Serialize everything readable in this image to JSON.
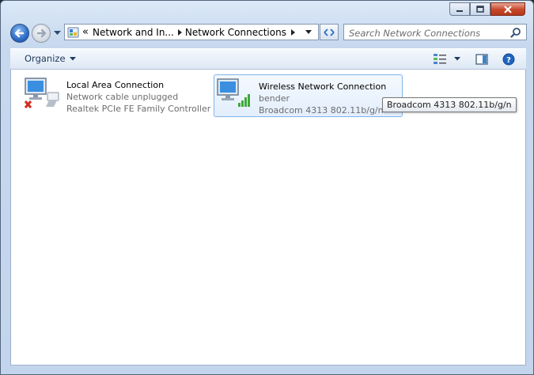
{
  "breadcrumb": {
    "root_chevron": "«",
    "segments": [
      "Network and In...",
      "Network Connections"
    ]
  },
  "search": {
    "placeholder": "Search Network Connections"
  },
  "toolbar": {
    "organize_label": "Organize"
  },
  "connections": [
    {
      "name": "Local Area Connection",
      "status": "Network cable unplugged",
      "device": "Realtek PCIe FE Family Controller",
      "icon": "wired-network-icon",
      "state": "disconnected"
    },
    {
      "name": "Wireless Network Connection",
      "status": "bender",
      "device": "Broadcom 4313 802.11b/g/n",
      "icon": "wireless-network-icon",
      "state": "connected",
      "selected": true
    }
  ],
  "tooltip": {
    "text": "Broadcom 4313 802.11b/g/n"
  },
  "colors": {
    "accent": "#2e6bc4",
    "close": "#c7472b",
    "selection": "#7eb4ea",
    "muted_text": "#6d6d6d"
  }
}
